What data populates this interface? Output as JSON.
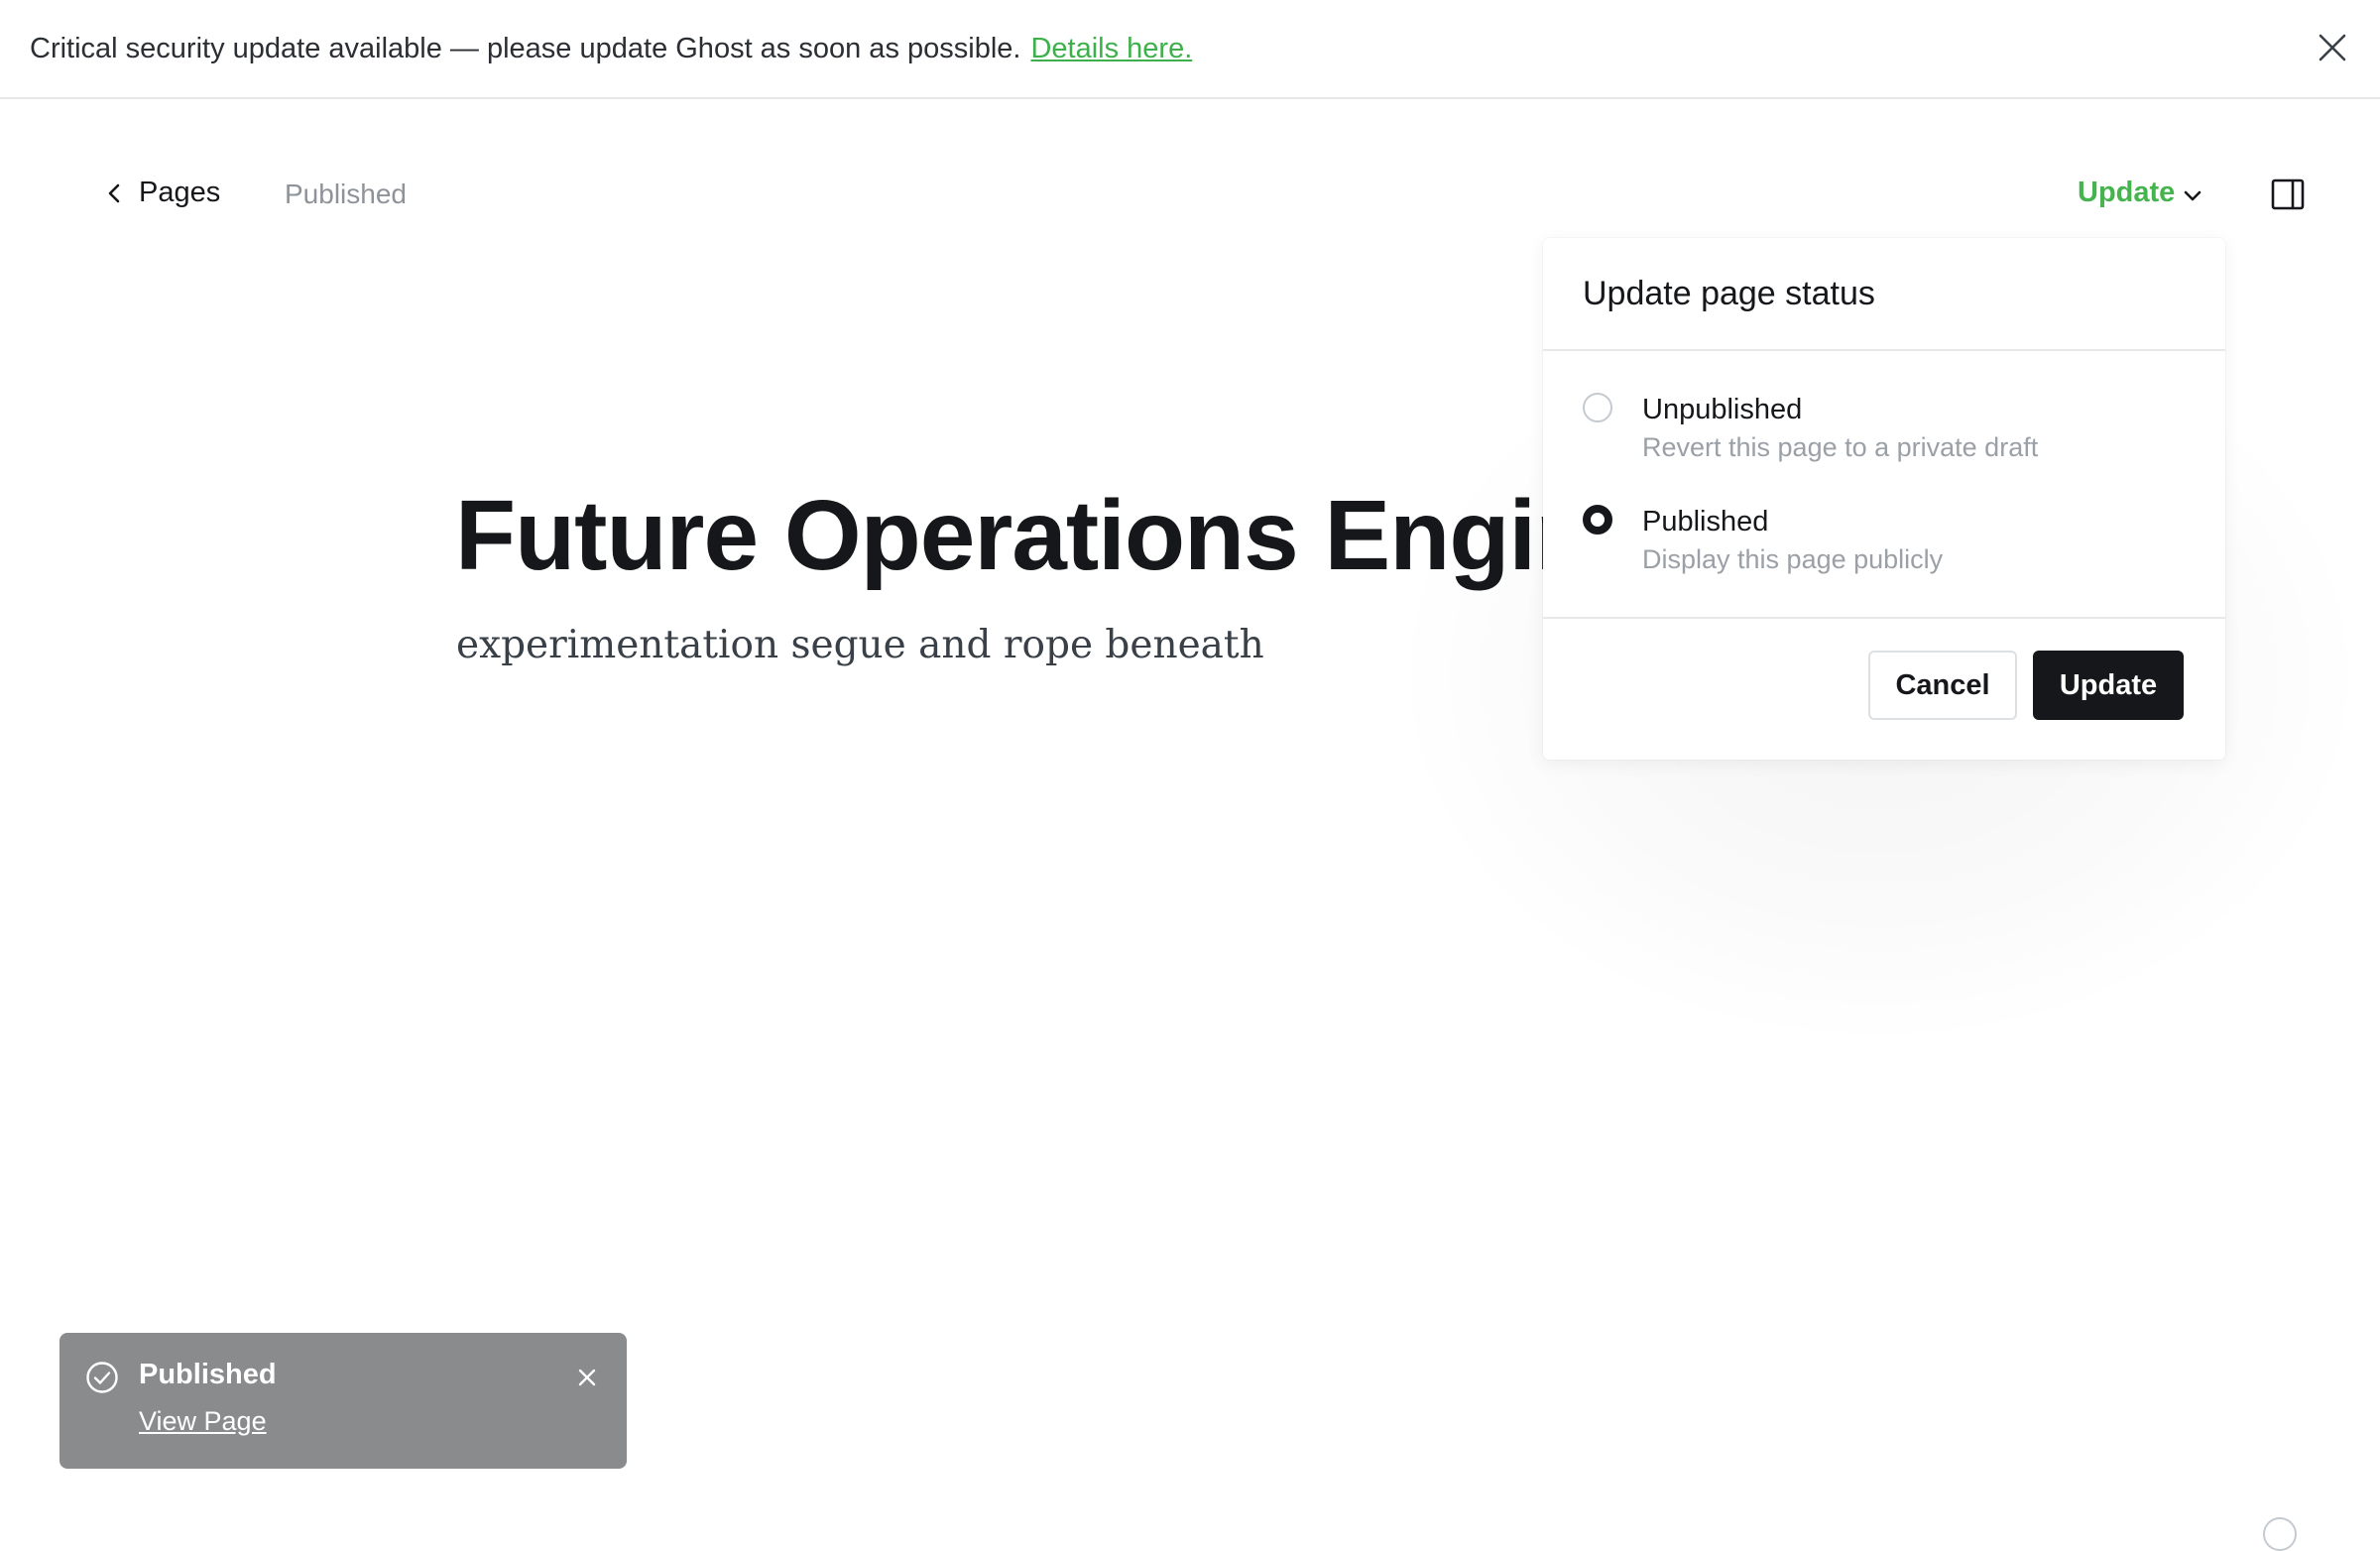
{
  "banner": {
    "message": "Critical security update available — please update Ghost as soon as possible.",
    "link_text": "Details here.",
    "close_icon": "close-icon"
  },
  "header": {
    "back_label": "Pages",
    "back_icon": "chevron-left-icon",
    "status": "Published",
    "update_label": "Update",
    "update_icon": "chevron-down-icon",
    "sidebar_icon": "sidebar-toggle-icon"
  },
  "content": {
    "title": "Future Operations Engine",
    "excerpt": "experimentation segue and rope beneath"
  },
  "popover": {
    "title": "Update page status",
    "options": [
      {
        "title": "Unpublished",
        "description": "Revert this page to a private draft",
        "checked": false
      },
      {
        "title": "Published",
        "description": "Display this page publicly",
        "checked": true
      }
    ],
    "cancel_label": "Cancel",
    "update_label": "Update"
  },
  "toast": {
    "title": "Published",
    "link_text": "View Page",
    "icon": "check-circle-icon",
    "close_icon": "close-icon"
  },
  "colors": {
    "accent_green": "#45b44f",
    "primary_dark": "#15171a",
    "muted_text": "#8e9399",
    "toast_bg": "#8a8b8c"
  }
}
